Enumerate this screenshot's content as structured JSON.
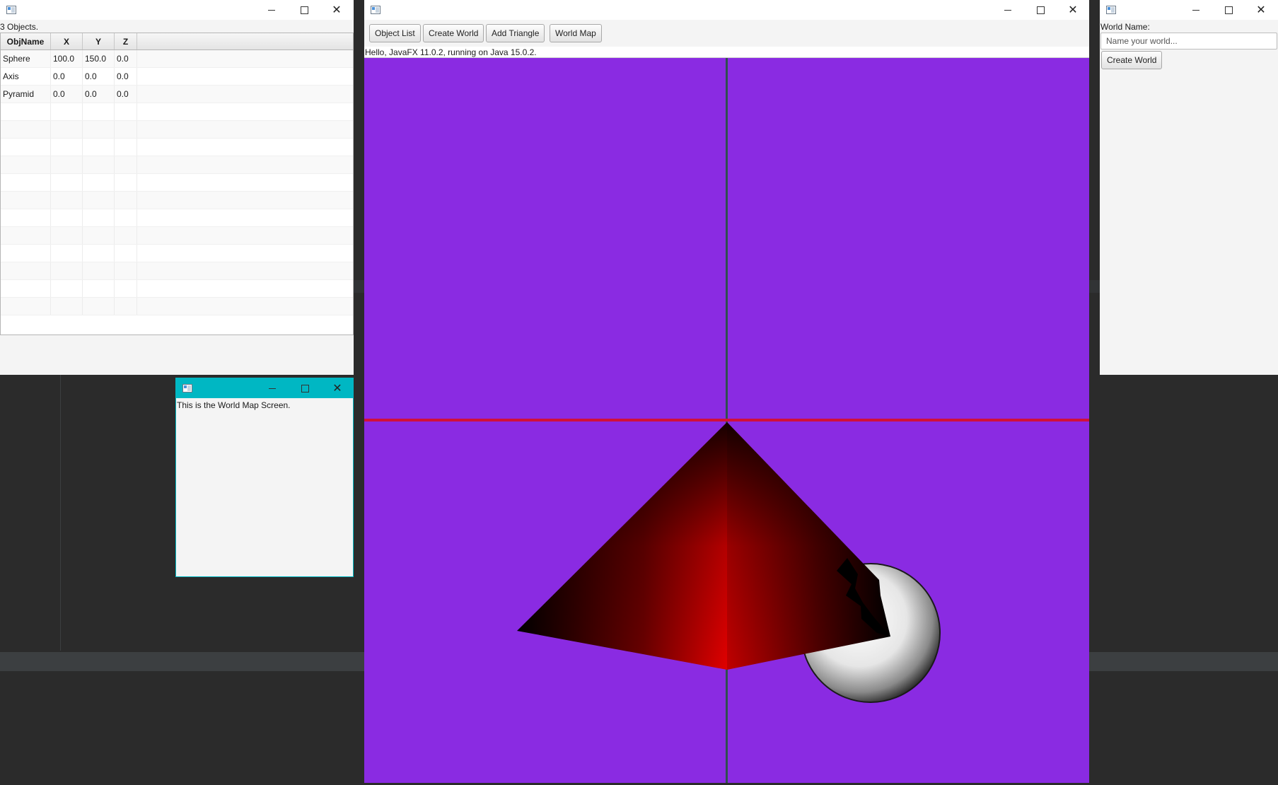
{
  "object_list_window": {
    "count_text": "3 Objects.",
    "columns": [
      "ObjName",
      "X",
      "Y",
      "Z"
    ],
    "rows": [
      [
        "Sphere",
        "100.0",
        "150.0",
        "0.0"
      ],
      [
        "Axis",
        "0.0",
        "0.0",
        "0.0"
      ],
      [
        "Pyramid",
        "0.0",
        "0.0",
        "0.0"
      ]
    ]
  },
  "world_map_window": {
    "text": "This is the World Map Screen.",
    "titlebar_color": "#00b7c3"
  },
  "main_window": {
    "toolbar": {
      "object_list_label": "Object List",
      "create_world_label": "Create World",
      "add_triangle_label": "Add Triangle",
      "world_map_label": "World Map"
    },
    "status_text": "Hello, JavaFX 11.0.2, running on Java 15.0.2.",
    "scene": {
      "background_color": "#8a2be2",
      "x_axis_color": "#d0103a",
      "y_axis_color": "#2f4f4f",
      "pyramid_color": "#e00000",
      "sphere_color": "#ffffff"
    }
  },
  "world_name_window": {
    "label": "World Name:",
    "input_placeholder": "Name your world...",
    "input_value": "",
    "create_button_label": "Create World"
  },
  "window_controls": {
    "minimize_icon": "minimize-icon",
    "maximize_icon": "maximize-icon",
    "close_icon": "close-icon",
    "close_glyph": "✕"
  }
}
